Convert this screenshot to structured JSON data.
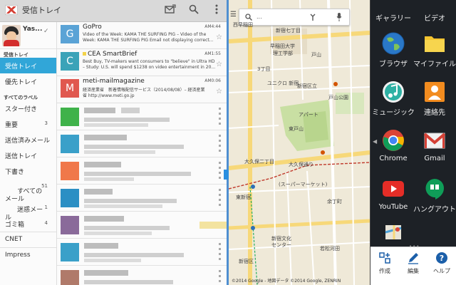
{
  "gmail": {
    "title": "受信トレイ",
    "account_name": "Yas...",
    "sections": {
      "inbox": "受信トレイ",
      "all_labels": "すべてのラベル"
    },
    "folders": [
      {
        "label": "受信トレイ",
        "count": "",
        "selected": true
      },
      {
        "label": "優先トレイ",
        "count": ""
      }
    ],
    "labels": [
      {
        "label": "スター付き",
        "count": ""
      },
      {
        "label": "重要",
        "count": "3"
      },
      {
        "label": "送信済みメール",
        "count": ""
      },
      {
        "label": "送信トレイ",
        "count": ""
      },
      {
        "label": "下書き",
        "count": ""
      },
      {
        "label": "すべての\nメール",
        "count": "51"
      },
      {
        "label": "迷惑メー\nル",
        "count": "1"
      },
      {
        "label": "ゴミ箱",
        "count": "4"
      },
      {
        "label": "CNET",
        "count": ""
      },
      {
        "label": "Impress",
        "count": ""
      }
    ],
    "messages": [
      {
        "initial": "G",
        "color": "#5aa3d6",
        "from": "GoPro",
        "time": "AM4:44",
        "line1": "Video of the Week: KAMA THE SURFING PIG – Video of the",
        "line2": "Week: KAMA THE SURFING PIG Email not displaying correct..."
      },
      {
        "initial": "C",
        "color": "#3ba3b8",
        "from": "CEA SmartBrief",
        "time": "AM1:55",
        "line1": "Best Buy, TV-makers want consumers to \"believe\" in Ultra HD",
        "line2": "– Study: U.S. will spend $1238 on video entertainment in 20..."
      },
      {
        "initial": "M",
        "color": "#e0584f",
        "from": "meti-mailmagazine",
        "time": "AM0:06",
        "line1": "経済産業省　新着情報配信サービス（2014/08/08）– 経済産業",
        "line2": "省 http://www.meti.go.jp"
      }
    ]
  },
  "maps": {
    "labels": [
      "西早稲田",
      "新宿七丁目",
      "早稲田大学",
      "理工学部",
      "戸山",
      "3丁目",
      "ユニクロ 新宿",
      "新宿区立",
      "戸山公園",
      "アパート",
      "東戸山",
      "大久保二丁目",
      "大久保通り",
      "(スーパーマーケット)",
      "東新宿",
      "余丁町",
      "新宿文化",
      "センター",
      "若松河田",
      "新宿区"
    ],
    "copyright": "©2014 Google - 地図データ ©2014 Google, ZENRIN"
  },
  "apps": {
    "items": [
      {
        "label": "ギャラリー"
      },
      {
        "label": "ビデオ"
      },
      {
        "label": "ブラウザ"
      },
      {
        "label": "マイファイル"
      },
      {
        "label": "ミュージック"
      },
      {
        "label": "連絡先"
      },
      {
        "label": "Chrome"
      },
      {
        "label": "Gmail"
      },
      {
        "label": "YouTube"
      },
      {
        "label": "ハングアウト"
      },
      {
        "label": ""
      },
      {
        "label": ""
      }
    ],
    "bottom": [
      {
        "label": "作成",
        "icon": "create-icon"
      },
      {
        "label": "編集",
        "icon": "edit-icon"
      },
      {
        "label": "ヘルプ",
        "icon": "help-icon"
      }
    ]
  },
  "colors": {
    "accent": "#31a6d8",
    "brand_red": "#d54136",
    "handle": "#2a8fe0"
  }
}
